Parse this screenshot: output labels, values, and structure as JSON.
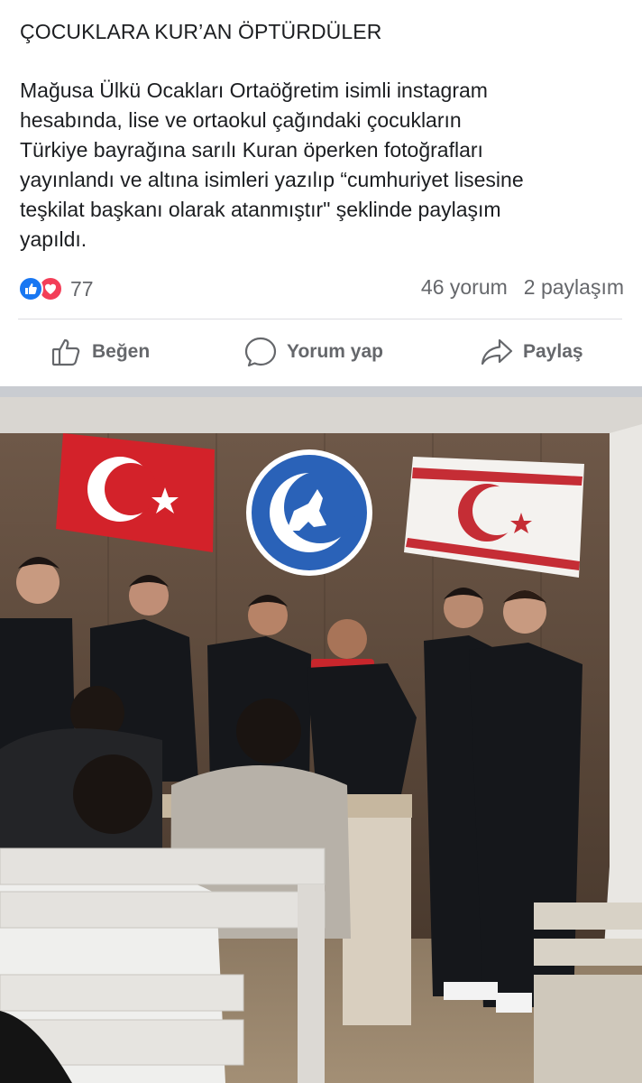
{
  "post": {
    "title": "ÇOCUKLARA KUR’AN ÖPTÜRDÜLER",
    "body": "Mağusa Ülkü Ocakları Ortaöğretim isimli instagram\nhesabında, lise ve ortaokul çağındaki çocukların\nTürkiye bayrağına sarılı Kuran öperken fotoğrafları\nyayınlandı ve altına isimleri yazılıp “cumhuriyet lisesine\nteşkilat başkanı olarak atanmıştır\" şeklinde paylaşım\nyapıldı.",
    "reactions": {
      "count": "77",
      "icons": [
        "like-icon",
        "love-icon"
      ]
    },
    "comments": "46 yorum",
    "shares": "2 paylaşım"
  },
  "actions": {
    "like_label": "Beğen",
    "comment_label": "Yorum yap",
    "share_label": "Paylaş"
  },
  "photo": {
    "description_icons": [
      "turkish-flag",
      "organization-emblem",
      "trnc-flag"
    ]
  },
  "colors": {
    "like_blue": "#1877f2",
    "love_red": "#f33e58",
    "secondary_text": "#65676b",
    "text": "#1c1e21"
  }
}
